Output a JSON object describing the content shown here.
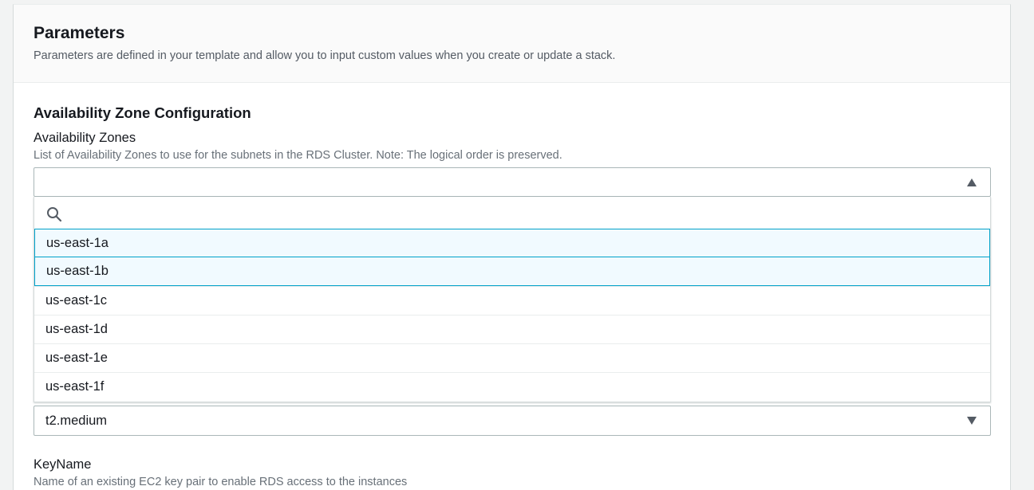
{
  "parameters": {
    "title": "Parameters",
    "description": "Parameters are defined in your template and allow you to input custom values when you create or update a stack."
  },
  "availability_section": {
    "title": "Availability Zone Configuration",
    "field_label": "Availability Zones",
    "field_description": "List of Availability Zones to use for the subnets in the RDS Cluster. Note: The logical order is preserved.",
    "search_placeholder": "",
    "options": [
      {
        "label": "us-east-1a",
        "selected": true
      },
      {
        "label": "us-east-1b",
        "selected": true
      },
      {
        "label": "us-east-1c",
        "selected": false
      },
      {
        "label": "us-east-1d",
        "selected": false
      },
      {
        "label": "us-east-1e",
        "selected": false
      },
      {
        "label": "us-east-1f",
        "selected": false
      }
    ]
  },
  "instance_type": {
    "value": "t2.medium"
  },
  "keyname": {
    "label": "KeyName",
    "description": "Name of an existing EC2 key pair to enable RDS access to the instances"
  },
  "colors": {
    "accent": "#00a1c9",
    "selected_bg": "#f1faff",
    "text": "#16191f",
    "muted": "#687078"
  },
  "icons": {
    "search": "search-icon",
    "caret_up": "caret-up-icon",
    "caret_down": "caret-down-icon"
  }
}
